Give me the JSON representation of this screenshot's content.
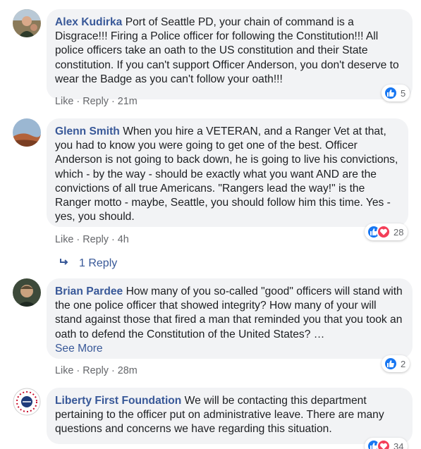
{
  "comments": [
    {
      "author": "Alex Kudirka",
      "text": "Port of Seattle PD, your chain of command is a Disgrace!!! Firing a Police officer for following the Constitution!!! All police officers take an oath to the US constitution and their State constitution. If you can't support Officer Anderson, you don't deserve to wear the Badge as you can't follow your oath!!!",
      "like_label": "Like",
      "reply_label": "Reply",
      "time": "21m",
      "reaction_count": "5",
      "reactions": [
        "like"
      ]
    },
    {
      "author": "Glenn Smith",
      "text": "When you hire a VETERAN, and a Ranger Vet at that, you had to know you were going to get one of the best. Officer Anderson is not going to back down, he is going to live his convictions, which - by the way - should be exactly what you want AND are the convictions of all true Americans. \"Rangers lead the way!\" is the Ranger motto - maybe, Seattle, you should follow him this time. Yes - yes, you should.",
      "like_label": "Like",
      "reply_label": "Reply",
      "time": "4h",
      "reaction_count": "28",
      "reactions": [
        "like",
        "love"
      ],
      "replies_label": "1 Reply"
    },
    {
      "author": "Brian Pardee",
      "text": "How many of you so-called \"good\" officers will stand with the one police officer that showed integrity? How many of your will stand against those that fired a man that reminded you that you took an oath to defend the Constitution of the United States? …",
      "see_more": "See More",
      "like_label": "Like",
      "reply_label": "Reply",
      "time": "28m",
      "reaction_count": "2",
      "reactions": [
        "like"
      ]
    },
    {
      "author": "Liberty First Foundation",
      "text": "We will be contacting this department pertaining to the officer put on administrative leave. There are many questions and concerns we have regarding this situation.",
      "reaction_count": "34",
      "reactions": [
        "like",
        "love"
      ]
    }
  ],
  "colors": {
    "author": "#385898",
    "bubble": "#f2f3f5",
    "like": "#1877f2",
    "love": "#f33e58",
    "meta": "#65676b"
  }
}
